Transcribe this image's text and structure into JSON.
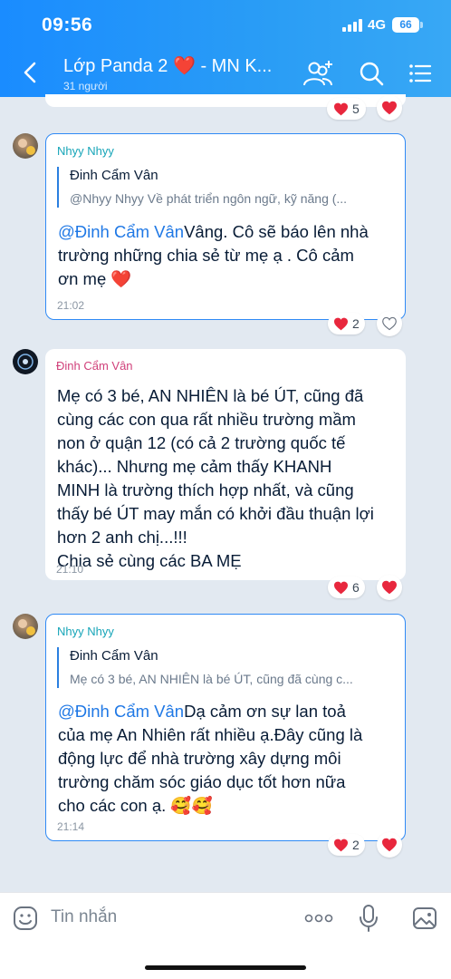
{
  "status_bar": {
    "time": "09:56",
    "network": "4G",
    "battery": "66"
  },
  "header": {
    "title": "Lớp Panda 2 ❤️ - MN K...",
    "subtitle": "31 người"
  },
  "top_partial": {
    "reaction_count": "5"
  },
  "messages": [
    {
      "sender": "Nhyy Nhyy",
      "sender_color": "#16a5b8",
      "quote_name": "Đinh Cẩm Vân",
      "quote_text": "@Nhyy Nhyy Về phát triển ngôn ngữ, kỹ năng (...",
      "mention": "@Đinh Cẩm Vân",
      "lines": [
        "Vâng. Cô sẽ báo lên nhà",
        "trường những chia sẻ từ mẹ ạ  . Cô cảm",
        "ơn mẹ ❤️"
      ],
      "time": "21:02",
      "reaction_count": "2"
    },
    {
      "sender": "Đinh Cẩm Vân",
      "sender_color": "#d0407a",
      "lines": [
        "Mẹ có 3 bé, AN NHIÊN là bé ÚT, cũng đã",
        "cùng các con qua rất nhiều trường mầm",
        "non ở quận 12 (có cả 2 trường quốc tế",
        "khác)... Nhưng mẹ cảm thấy KHANH",
        "MINH là trường thích hợp nhất, và cũng",
        "thấy bé ÚT may mắn có khởi đầu thuận lợi",
        "hơn 2 anh chị...!!!",
        "Chia sẻ cùng các BA MẸ"
      ],
      "time": "21:10",
      "reaction_count": "6"
    },
    {
      "sender": "Nhyy Nhyy",
      "sender_color": "#16a5b8",
      "quote_name": "Đinh Cẩm Vân",
      "quote_text": "Mẹ có 3 bé, AN NHIÊN là bé ÚT, cũng đã cùng c...",
      "mention": "@Đinh Cẩm Vân",
      "lines": [
        "Dạ  cảm ơn sự lan toả",
        "của mẹ An Nhiên rất nhiều ạ.Đây cũng là",
        "động lực để nhà trường xây dựng môi",
        "trường chăm sóc giáo dục tốt hơn nữa",
        "cho các con ạ. 🥰🥰"
      ],
      "time": "21:14",
      "reaction_count": "2"
    }
  ],
  "composer": {
    "placeholder": "Tin nhắn"
  },
  "colors": {
    "header_blue": "#1a8cff",
    "bubble_border": "#2f8af5",
    "heart": "#e8273d",
    "mention": "#1f78e5"
  },
  "icons": [
    "back-arrow-icon",
    "add-member-icon",
    "search-icon",
    "menu-list-icon",
    "heart-icon",
    "heart-outline-icon",
    "sticker-icon",
    "more-icon",
    "microphone-icon",
    "image-icon"
  ]
}
